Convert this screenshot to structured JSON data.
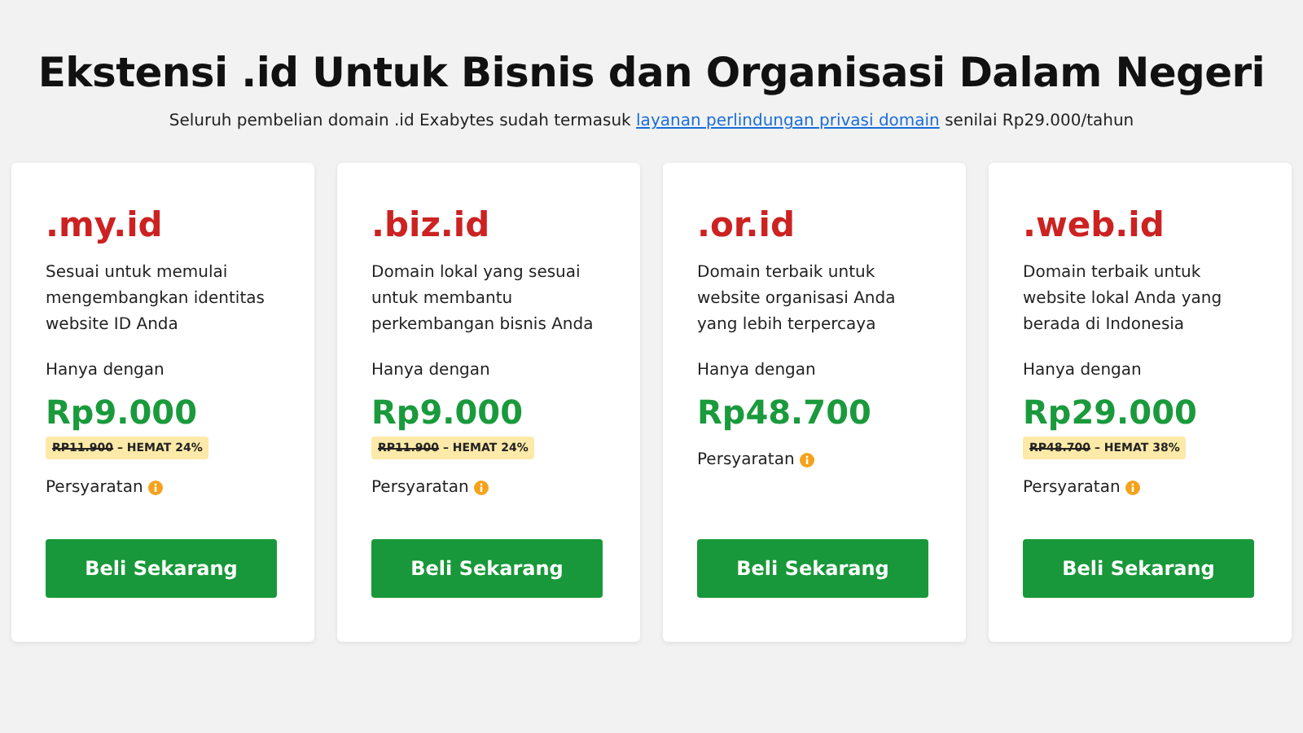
{
  "heading": "Ekstensi .id Untuk Bisnis dan Organisasi Dalam Negeri",
  "subtitle": {
    "before": "Seluruh pembelian domain .id Exabytes sudah termasuk",
    "link": "layanan perlindungan privasi domain",
    "after": "senilai Rp29.000/tahun"
  },
  "cards": [
    {
      "name": ".my.id",
      "description": "Sesuai untuk memulai mengembangkan identitas website ID Anda",
      "price_label": "Hanya dengan",
      "price": "Rp9.000",
      "old_price": "RP11.900",
      "saving": "– HEMAT 24%",
      "terms": "Persyaratan",
      "button": "Beli Sekarang"
    },
    {
      "name": ".biz.id",
      "description": "Domain lokal yang sesuai untuk membantu perkembangan bisnis Anda",
      "price_label": "Hanya dengan",
      "price": "Rp9.000",
      "old_price": "RP11.900",
      "saving": "– HEMAT 24%",
      "terms": "Persyaratan",
      "button": "Beli Sekarang"
    },
    {
      "name": ".or.id",
      "description": "Domain terbaik untuk website organisasi Anda yang lebih terpercaya",
      "price_label": "Hanya dengan",
      "price": "Rp48.700",
      "terms": "Persyaratan",
      "button": "Beli Sekarang"
    },
    {
      "name": ".web.id",
      "description": "Domain terbaik untuk website lokal Anda yang berada di Indonesia",
      "price_label": "Hanya dengan",
      "price": "Rp29.000",
      "old_price": "RP48.700",
      "saving": "– HEMAT 38%",
      "terms": "Persyaratan",
      "button": "Beli Sekarang"
    }
  ]
}
